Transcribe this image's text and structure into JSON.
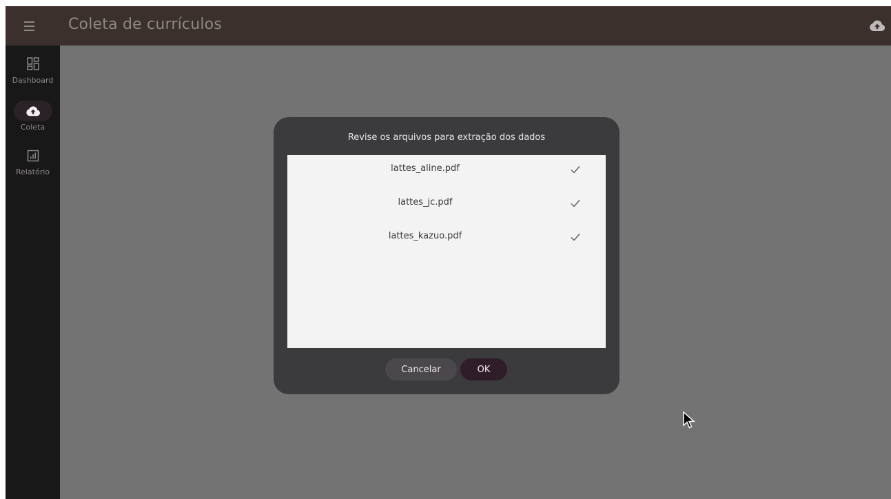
{
  "appbar": {
    "title": "Coleta de currículos",
    "menu_icon": "menu-icon",
    "upload_icon": "cloud-upload-icon"
  },
  "rail": {
    "items": [
      {
        "label": "Dashboard",
        "icon": "dashboard-icon",
        "active": false
      },
      {
        "label": "Coleta",
        "icon": "cloud-upload-icon",
        "active": true
      },
      {
        "label": "Relatório",
        "icon": "report-icon",
        "active": false
      }
    ]
  },
  "dialog": {
    "title": "Revise os arquivos para extração dos dados",
    "files": [
      {
        "name": "lattes_aline.pdf",
        "status_icon": "check-icon"
      },
      {
        "name": "lattes_jc.pdf",
        "status_icon": "check-icon"
      },
      {
        "name": "lattes_kazuo.pdf",
        "status_icon": "check-icon"
      }
    ],
    "cancel_label": "Cancelar",
    "ok_label": "OK"
  },
  "colors": {
    "appbar_bg": "#3c302c",
    "rail_bg": "#181818",
    "scrim": "#737373",
    "dialog_bg": "#3b3a3d",
    "list_bg": "#f4f3f3",
    "ok_bg": "#2f1d2a"
  }
}
